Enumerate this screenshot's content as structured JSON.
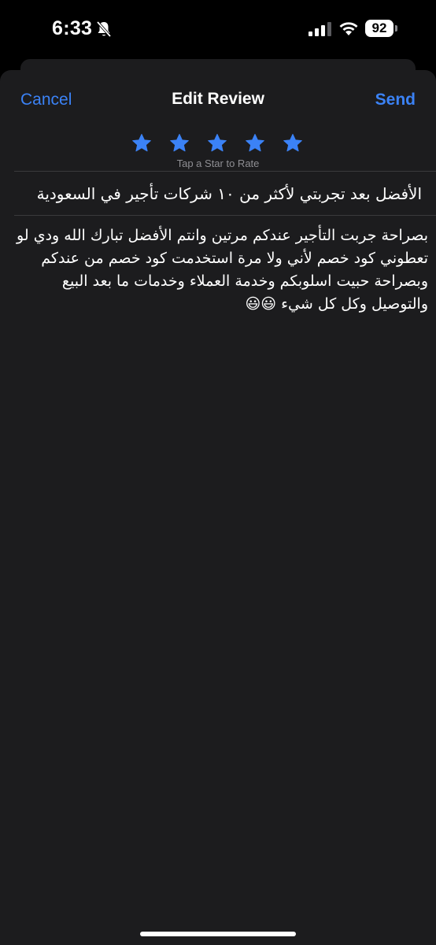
{
  "status_bar": {
    "time": "6:33",
    "battery_level": "92",
    "icons": [
      "bell-slash-icon",
      "signal-icon",
      "wifi-icon",
      "battery-icon"
    ]
  },
  "nav": {
    "cancel_label": "Cancel",
    "title": "Edit Review",
    "send_label": "Send"
  },
  "rating": {
    "value": 5,
    "max": 5,
    "hint": "Tap a Star to Rate",
    "star_color": "#3b82f6"
  },
  "review": {
    "title": "الأفضل بعد تجربتي لأكثر من ١٠ شركات تأجير في السعودية",
    "body": "بصراحة جربت التأجير عندكم مرتين وانتم الأفضل تبارك الله ودي لو تعطوني كود خصم لأني ولا مرة استخدمت كود خصم من عندكم وبصراحة حبيت اسلوبكم وخدمة العملاء وخدمات ما بعد البيع والتوصيل وكل كل شيء 😃😃"
  },
  "colors": {
    "accent": "#3b82f6",
    "sheet_background": "#1c1c1e",
    "divider": "#3a3a3c",
    "secondary_text": "#8e8e93"
  }
}
